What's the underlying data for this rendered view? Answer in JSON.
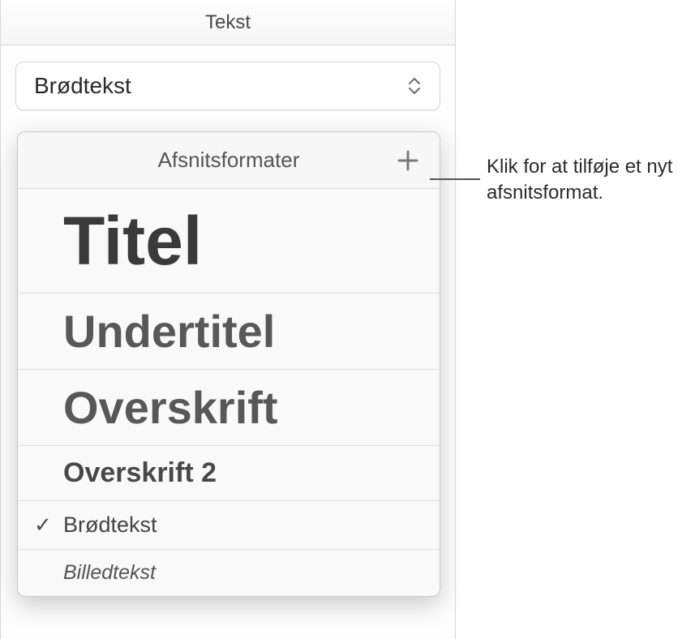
{
  "tab": {
    "label": "Tekst"
  },
  "dropdown": {
    "value": "Brødtekst"
  },
  "popover": {
    "title": "Afsnitsformater",
    "styles": [
      {
        "label": "Titel",
        "class": "titel-text",
        "checked": false
      },
      {
        "label": "Undertitel",
        "class": "undertitel-text",
        "checked": false
      },
      {
        "label": "Overskrift",
        "class": "overskrift-text",
        "checked": false
      },
      {
        "label": "Overskrift 2",
        "class": "overskrift2-text",
        "checked": false
      },
      {
        "label": "Brødtekst",
        "class": "brodtekst-text",
        "checked": true
      },
      {
        "label": "Billedtekst",
        "class": "billedtekst-text",
        "checked": false
      }
    ]
  },
  "callout": {
    "text": "Klik for at tilføje et nyt afsnitsformat."
  }
}
